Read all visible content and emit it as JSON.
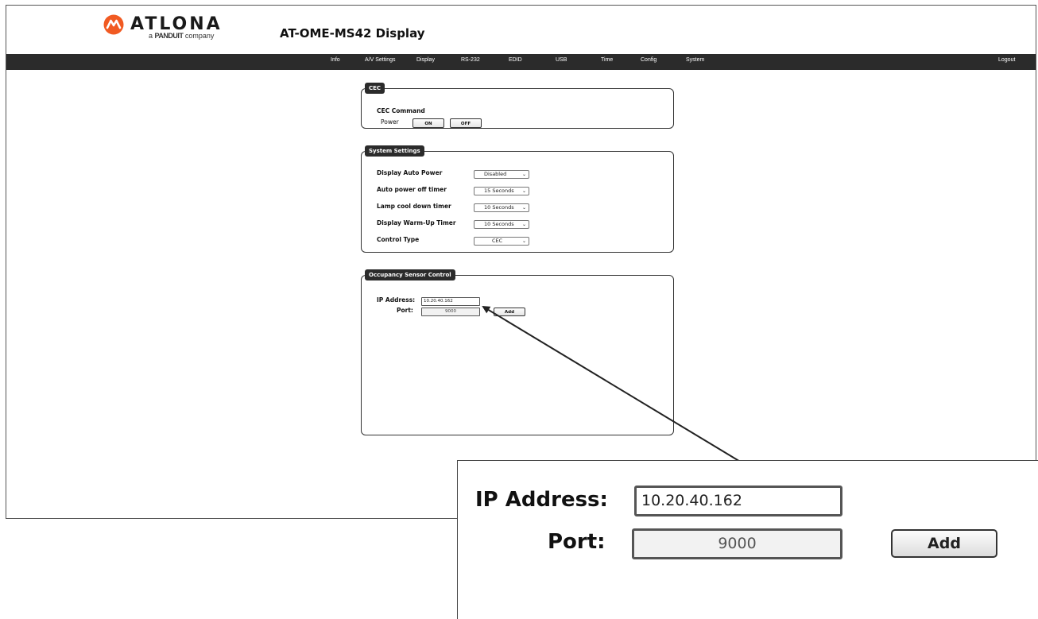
{
  "brand": {
    "name": "ATLONA",
    "sub_prefix": "a",
    "sub_brand": "PANDUIT",
    "sub_suffix": "company",
    "accent": "#f15a22"
  },
  "page": {
    "title": "AT-OME-MS42  Display"
  },
  "nav": {
    "items": [
      "Info",
      "A/V Settings",
      "Display",
      "RS-232",
      "EDID",
      "USB",
      "Time",
      "Config",
      "System"
    ],
    "logout": "Logout"
  },
  "cec": {
    "legend": "CEC",
    "command_label": "CEC Command",
    "power_label": "Power",
    "on_label": "ON",
    "off_label": "OFF"
  },
  "system": {
    "legend": "System Settings",
    "rows": [
      {
        "label": "Display Auto Power",
        "value": "Disabled"
      },
      {
        "label": "Auto power off timer",
        "value": "15 Seconds"
      },
      {
        "label": "Lamp cool down timer",
        "value": "10 Seconds"
      },
      {
        "label": "Display Warm-Up Timer",
        "value": "10 Seconds"
      },
      {
        "label": "Control Type",
        "value": "CEC"
      }
    ]
  },
  "occupancy": {
    "legend": "Occupancy Sensor Control",
    "ip_label": "IP Address:",
    "ip_value": "10.20.40.162",
    "port_label": "Port:",
    "port_value": "9000",
    "add_label": "Add"
  }
}
